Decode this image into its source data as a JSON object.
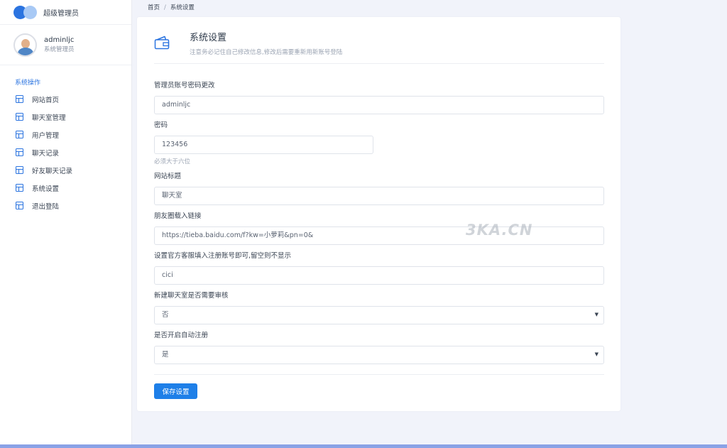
{
  "brand": {
    "title": "超级管理员"
  },
  "user": {
    "name": "adminljc",
    "role": "系统管理员"
  },
  "sidebar": {
    "section_title": "系统操作",
    "items": [
      {
        "label": "网站首页"
      },
      {
        "label": "聊天室管理"
      },
      {
        "label": "用户管理"
      },
      {
        "label": "聊天记录"
      },
      {
        "label": "好友聊天记录"
      },
      {
        "label": "系统设置"
      },
      {
        "label": "退出登陆"
      }
    ]
  },
  "breadcrumb": {
    "home": "首页",
    "separator": "/",
    "current": "系统设置"
  },
  "card": {
    "title": "系统设置",
    "subtitle": "注意务必记住自己修改信息,修改后需要重新用新账号登陆"
  },
  "form": {
    "account_label": "管理员账号密码更改",
    "account_value": "adminljc",
    "password_label": "密码",
    "password_value": "123456",
    "password_hint": "必须大于六位",
    "site_title_label": "网站标题",
    "site_title_value": "聊天室",
    "moments_label": "朋友圈载入链接",
    "moments_value": "https://tieba.baidu.com/f?kw=小萝莉&pn=0&",
    "service_label": "设置官方客服填入注册账号即可,留空则不显示",
    "service_value": "cici",
    "review_label": "新建聊天室是否需要审核",
    "review_value": "否",
    "autoreg_label": "是否开启自动注册",
    "autoreg_value": "是",
    "save_label": "保存设置"
  },
  "watermark": "3KA.CN",
  "colors": {
    "accent": "#1e7fe8",
    "brand_dark": "#2b74e0",
    "brand_light": "#a8c9f5",
    "bottom_bar": "#8aa2e6"
  },
  "icons": {
    "menu": "layout-icon",
    "header": "wallet-icon",
    "select": "caret-down-icon"
  }
}
